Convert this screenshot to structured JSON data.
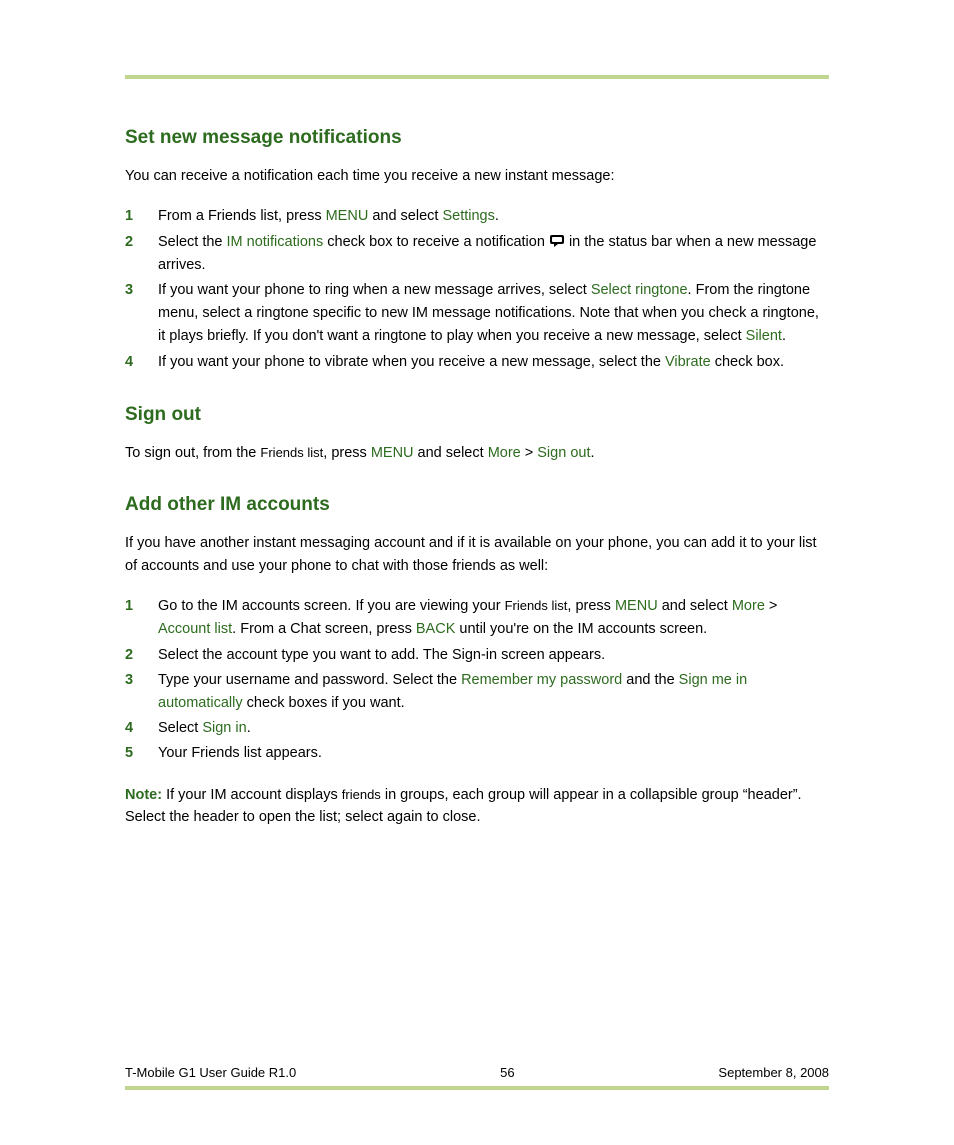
{
  "sections": {
    "s1": {
      "title": "Set new message notifications",
      "intro": "You can receive a notification each time you receive a new instant message:",
      "steps": {
        "n1": "1",
        "t1a": "From a Friends list, press ",
        "t1b": "MENU",
        "t1c": " and select ",
        "t1d": "Settings",
        "t1e": ".",
        "n2": "2",
        "t2a": "Select the ",
        "t2b": "IM notifications",
        "t2c": " check box to receive a notification ",
        "t2d": " in the status bar when a new message arrives.",
        "n3": "3",
        "t3a": "If you want your phone to ring when a new message arrives, select ",
        "t3b": "Select ringtone",
        "t3c": ". From the ringtone menu, select a ringtone specific to new IM message notifications. Note that when you check a ringtone, it plays briefly. If you don't want a ringtone to play when you receive a new message, select ",
        "t3d": "Silent",
        "t3e": ".",
        "n4": "4",
        "t4a": "If you want your phone to vibrate when you receive a new message, select the ",
        "t4b": "Vibrate",
        "t4c": " check box."
      }
    },
    "s2": {
      "title": "Sign out",
      "p1a": "To sign out, from the ",
      "p1b": "Friends list",
      "p1c": ", press ",
      "p1d": "MENU",
      "p1e": " and select ",
      "p1f": "More",
      "p1g": " > ",
      "p1h": "Sign out",
      "p1i": "."
    },
    "s3": {
      "title": "Add other IM accounts",
      "intro": "If you have another instant messaging account and if it is available on your phone, you can add it to your list of accounts and use your phone to chat with those friends as well:",
      "steps": {
        "n1": "1",
        "t1a": "Go to the IM accounts screen. If you are viewing your ",
        "t1b": "Friends list",
        "t1c": ", press ",
        "t1d": "MENU",
        "t1e": " and select ",
        "t1f": "More",
        "t1g": " > ",
        "t1h": "Account list",
        "t1i": ". From a Chat screen, press ",
        "t1j": "BACK",
        "t1k": " until you're on the IM accounts screen.",
        "n2": "2",
        "t2": "Select the account type you want to add. The Sign-in screen appears.",
        "n3": "3",
        "t3a": "Type your username and password. Select the ",
        "t3b": "Remember my password",
        "t3c": " and the ",
        "t3d": "Sign me in automatically",
        "t3e": " check boxes if you want.",
        "n4": "4",
        "t4a": "Select ",
        "t4b": "Sign in",
        "t4c": ".",
        "n5": "5",
        "t5": "Your Friends list appears."
      },
      "noteLabel": "Note:",
      "note1": " If your IM account displays ",
      "note2": "friends",
      "note3": " in groups, each group will appear in a collapsible group “header”. Select the header to open the list; select again to close."
    }
  },
  "footer": {
    "left": "T-Mobile G1 User Guide R1.0",
    "center": "56",
    "right": "September 8, 2008"
  }
}
